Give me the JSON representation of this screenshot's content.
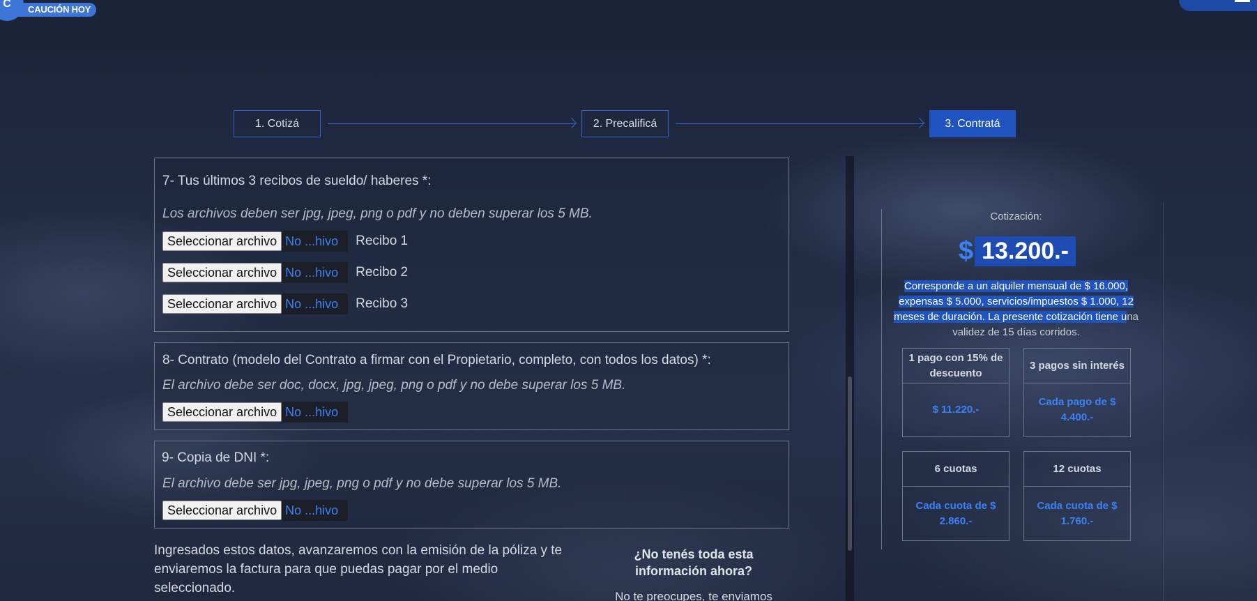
{
  "header": {
    "logo_mark": "C",
    "logo_text": "CAUCIÓN HOY"
  },
  "steps": [
    {
      "label": "1. Cotizá"
    },
    {
      "label": "2. Precalificá"
    },
    {
      "label": "3. Contratá"
    }
  ],
  "sections": {
    "recibos": {
      "title": "7- Tus últimos 3 recibos de sueldo/ haberes *:",
      "note": "Los archivos deben ser jpg, jpeg, png o pdf y no deben superar los 5 MB.",
      "files": [
        {
          "button": "Seleccionar archivo",
          "status": "No ...hivo",
          "label": "Recibo 1"
        },
        {
          "button": "Seleccionar archivo",
          "status": "No ...hivo",
          "label": "Recibo 2"
        },
        {
          "button": "Seleccionar archivo",
          "status": "No ...hivo",
          "label": "Recibo 3"
        }
      ]
    },
    "contrato": {
      "title": "8- Contrato (modelo del Contrato a firmar con el Propietario, completo, con todos los datos) *:",
      "note": "El archivo debe ser doc, docx, jpg, jpeg, png o pdf y no debe superar los 5 MB.",
      "button": "Seleccionar archivo",
      "status": "No ...hivo"
    },
    "dni": {
      "title": "9- Copia de DNI *:",
      "note": "El archivo debe ser jpg, jpeg, png o pdf y no debe superar los 5 MB.",
      "button": "Seleccionar archivo",
      "status": "No ...hivo"
    }
  },
  "footer": {
    "text": "Ingresados estos datos, avanzaremos con la emisión de la póliza y te enviaremos la factura para que puedas pagar por el medio seleccionado.",
    "help_title": "¿No tenés toda esta información ahora?",
    "help_sub": "No te preocupes, te enviamos"
  },
  "quote": {
    "label": "Cotización:",
    "currency": "$",
    "amount": "13.200.-",
    "desc_highlighted": "Corresponde a un alquiler mensual de $ 16.000, expensas $ 5.000, servicios/impuestos $ 1.000, 12 meses de duración. La presente cotización tiene u",
    "desc_rest": "na validez de 15 días corridos.",
    "cards": [
      {
        "head": "1 pago con 15% de descuento",
        "body": "$ 11.220.-"
      },
      {
        "head": "3 pagos sin interés",
        "body": "Cada pago de $ 4.400.-"
      },
      {
        "head": "6 cuotas",
        "body": "Cada cuota de $ 2.860.-"
      },
      {
        "head": "12 cuotas",
        "body": "Cada cuota de $ 1.760.-"
      }
    ]
  },
  "colors": {
    "accent": "#1f54c0",
    "link": "#3b82f6",
    "background": "#202a42"
  }
}
